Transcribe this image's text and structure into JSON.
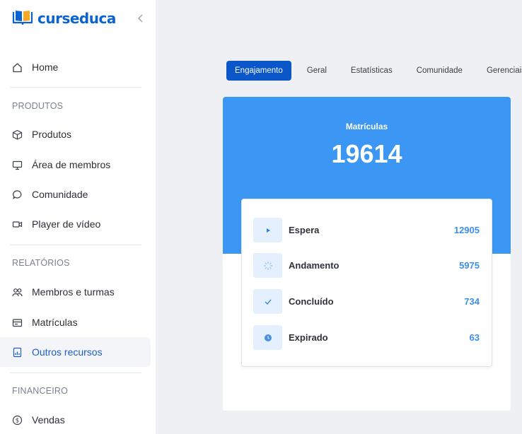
{
  "brand": {
    "name": "curseduca",
    "color": "#0b63d1"
  },
  "sidebar": {
    "home": {
      "label": "Home",
      "icon": "home-icon"
    },
    "sections": [
      {
        "title": "PRODUTOS",
        "items": [
          {
            "label": "Produtos",
            "icon": "box-icon"
          },
          {
            "label": "Área de membros",
            "icon": "monitor-icon"
          },
          {
            "label": "Comunidade",
            "icon": "chat-icon"
          },
          {
            "label": "Player de vídeo",
            "icon": "video-icon"
          }
        ]
      },
      {
        "title": "RELATÓRIOS",
        "items": [
          {
            "label": "Membros e turmas",
            "icon": "users-icon"
          },
          {
            "label": "Matrículas",
            "icon": "enrollment-icon"
          },
          {
            "label": "Outros recursos",
            "icon": "report-icon",
            "active": true
          }
        ]
      },
      {
        "title": "FINANCEIRO",
        "items": [
          {
            "label": "Vendas",
            "icon": "dollar-icon"
          }
        ]
      }
    ]
  },
  "tabs": [
    {
      "label": "Engajamento",
      "active": true
    },
    {
      "label": "Geral"
    },
    {
      "label": "Estatísticas"
    },
    {
      "label": "Comunidade"
    },
    {
      "label": "Gerenciais"
    }
  ],
  "card": {
    "title": "Matrículas",
    "total": "19614",
    "header_color": "#3b97f3",
    "statuses": [
      {
        "label": "Espera",
        "value": "12905",
        "icon": "play-icon"
      },
      {
        "label": "Andamento",
        "value": "5975",
        "icon": "loading-icon"
      },
      {
        "label": "Concluído",
        "value": "734",
        "icon": "check-icon"
      },
      {
        "label": "Expirado",
        "value": "63",
        "icon": "clock-icon"
      }
    ]
  }
}
